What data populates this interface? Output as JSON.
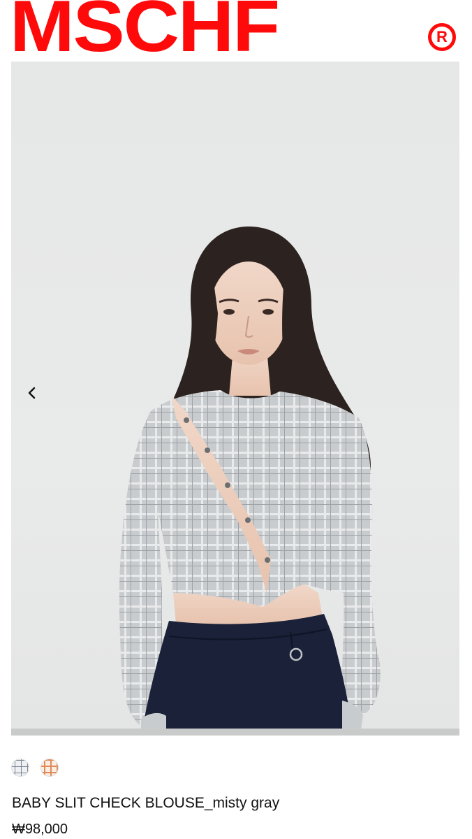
{
  "header": {
    "logo_text": "MSCHF",
    "registered_mark": "R",
    "brand_color": "#ff0a0a"
  },
  "gallery": {
    "prev_icon": "chevron-left-icon",
    "background_color": "#e8e9e9"
  },
  "swatches": [
    {
      "name": "misty gray",
      "icon": "check-pattern-gray"
    },
    {
      "name": "orange",
      "icon": "check-pattern-orange"
    }
  ],
  "product": {
    "name": "BABY SLIT CHECK BLOUSE_misty gray",
    "price": "₩98,000"
  }
}
